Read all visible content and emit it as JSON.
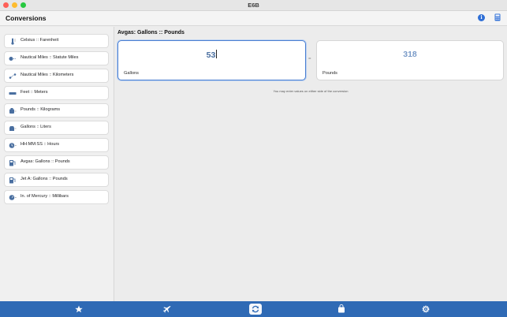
{
  "window": {
    "title": "E6B"
  },
  "toolbar": {
    "title": "Conversions",
    "info_icon": "info-icon",
    "calculator_icon": "calculator-icon"
  },
  "sidebar": {
    "items": [
      {
        "label": "Celsius :: Farenheit",
        "icon": "thermometer-icon"
      },
      {
        "label": "Nautical Miles :: Statute Miles",
        "icon": "distance-icon"
      },
      {
        "label": "Nautical Miles :: Kilometers",
        "icon": "route-icon"
      },
      {
        "label": "Feet :: Meters",
        "icon": "ruler-icon"
      },
      {
        "label": "Pounds :: Kilograms",
        "icon": "weight-icon"
      },
      {
        "label": "Gallons :: Liters",
        "icon": "fuel-drop-icon"
      },
      {
        "label": "HH:MM:SS :: Hours",
        "icon": "clock-icon"
      },
      {
        "label": "Avgas: Gallons :: Pounds",
        "icon": "fuel-pump-icon"
      },
      {
        "label": "Jet A: Gallons :: Pounds",
        "icon": "fuel-pump-icon"
      },
      {
        "label": "In. of Mercury :: Millibars",
        "icon": "gauge-icon"
      }
    ]
  },
  "main": {
    "title": "Avgas: Gallons :: Pounds",
    "left": {
      "value": "53",
      "unit": "Gallons"
    },
    "equals": "=",
    "right": {
      "value": "318",
      "unit": "Pounds"
    },
    "hint": "You may enter values on either side of the conversion"
  },
  "tabs": [
    {
      "icon": "star-icon",
      "active": false
    },
    {
      "icon": "airplane-icon",
      "active": false
    },
    {
      "icon": "conversion-icon",
      "active": true
    },
    {
      "icon": "bag-icon",
      "active": false
    },
    {
      "icon": "gear-icon",
      "active": false
    }
  ],
  "colors": {
    "accent": "#2f6ab5",
    "value_left": "#4a6fa0",
    "value_right": "#7a9bc8"
  }
}
